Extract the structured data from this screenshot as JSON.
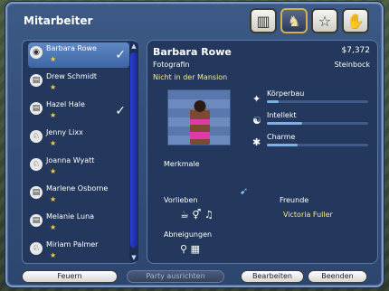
{
  "title": "Mitarbeiter",
  "header_buttons": [
    "buildings-icon",
    "playboy-bunny-icon",
    "star-icon",
    "handshake-icon"
  ],
  "list": {
    "items": [
      {
        "name": "Barbara Rowe",
        "icon": "camera-icon",
        "checked": true,
        "selected": true
      },
      {
        "name": "Drew Schmidt",
        "icon": "paper-icon",
        "checked": false,
        "selected": false
      },
      {
        "name": "Hazel Hale",
        "icon": "paper-icon",
        "checked": true,
        "selected": false
      },
      {
        "name": "Jenny Lixx",
        "icon": "bunny-icon",
        "checked": false,
        "selected": false
      },
      {
        "name": "Joanna Wyatt",
        "icon": "bunny-icon",
        "checked": false,
        "selected": false
      },
      {
        "name": "Marlene Osborne",
        "icon": "paper-icon",
        "checked": false,
        "selected": false
      },
      {
        "name": "Melanie Luna",
        "icon": "paper-icon",
        "checked": false,
        "selected": false
      },
      {
        "name": "Miriam Palmer",
        "icon": "bunny-icon",
        "checked": false,
        "selected": false
      }
    ]
  },
  "detail": {
    "name": "Barbara Rowe",
    "money": "$7,372",
    "job": "Fotografin",
    "sign": "Steinbock",
    "status": "Nicht in der Mansion",
    "skills": [
      {
        "label": "Körperbau",
        "icon": "body-icon",
        "level": 0.12
      },
      {
        "label": "Intellekt",
        "icon": "brain-icon",
        "level": 0.35
      },
      {
        "label": "Charme",
        "icon": "charm-icon",
        "level": 0.3
      }
    ],
    "traits_label": "Merkmale",
    "likes_label": "Vorlieben",
    "friends_label": "Freunde",
    "friend": "Victoria Fuller",
    "dislikes_label": "Abneigungen"
  },
  "buttons": {
    "fire": "Feuern",
    "party": "Party ausrichten",
    "edit": "Bearbeiten",
    "close": "Beenden"
  }
}
